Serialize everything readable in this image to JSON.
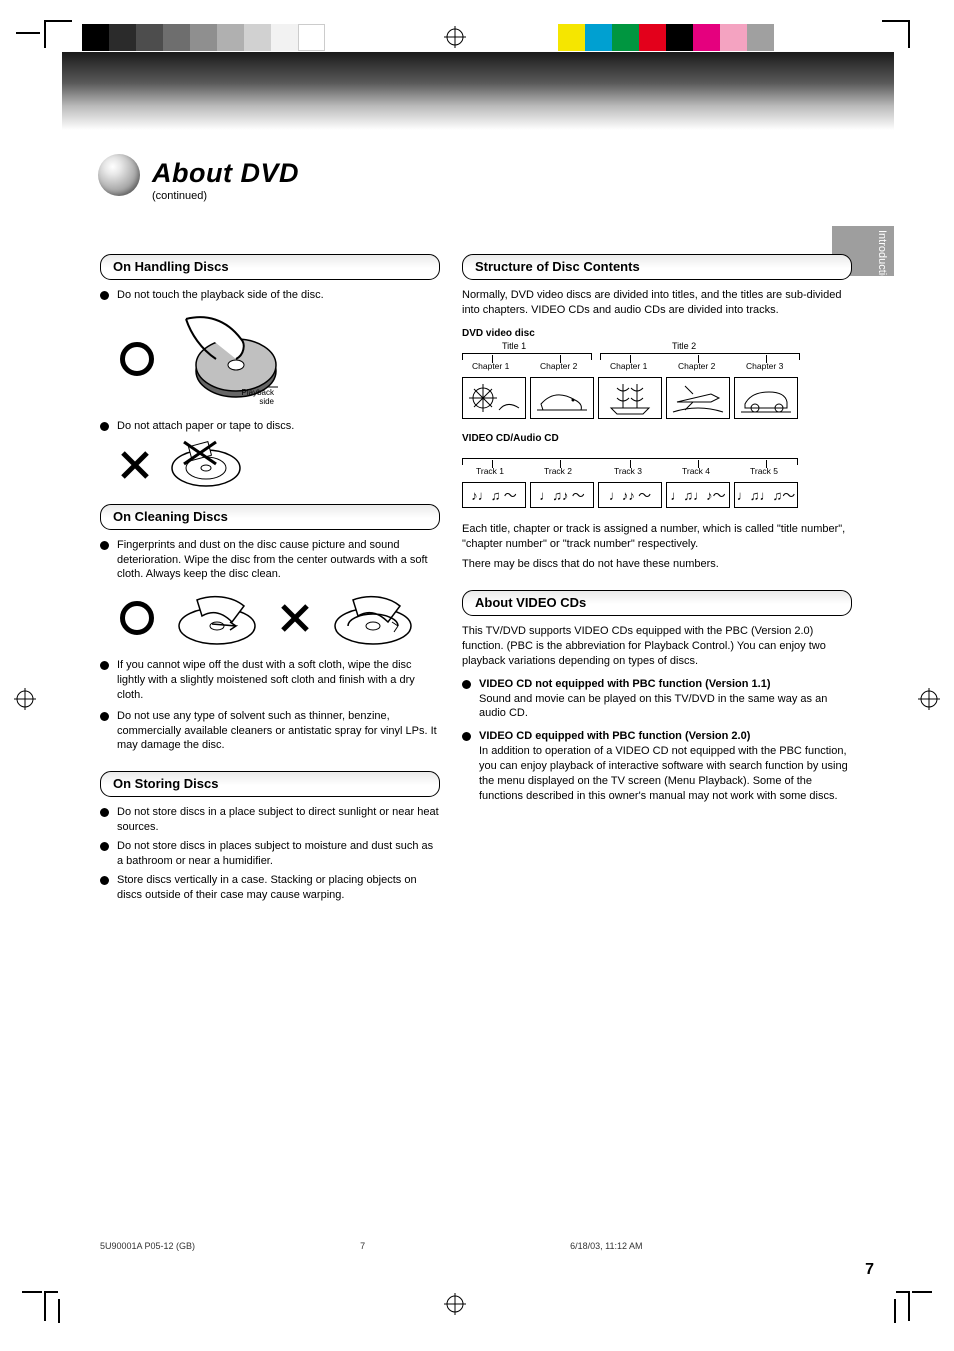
{
  "header": {
    "title": "About DVD",
    "subtitle": "(continued)"
  },
  "side_tab": "Introduction",
  "sections": {
    "handling": {
      "heading": "On Handling Discs",
      "b1": "Do not touch the playback side of the disc.",
      "b2": "Do not attach paper or tape to discs.",
      "img_labels": {
        "playback_side": "Playback side"
      }
    },
    "cleaning": {
      "heading": "On Cleaning Discs",
      "b1": "Fingerprints and dust on the disc cause picture and sound deterioration. Wipe the disc from the center outwards with a soft cloth. Always keep the disc clean.",
      "b2": "If you cannot wipe off the dust with a soft cloth, wipe the disc lightly with a slightly moistened soft cloth and finish with a dry cloth.",
      "b3": "Do not use any type of solvent such as thinner, benzine, commercially available cleaners or antistatic spray for vinyl LPs. It may damage the disc."
    },
    "storing": {
      "heading": "On Storing Discs",
      "b1": "Do not store discs in a place subject to direct sunlight or near heat sources.",
      "b2": "Do not store discs in places subject to moisture and dust such as a bathroom or near a humidifier.",
      "b3": "Store discs vertically in a case. Stacking or placing objects on discs outside of their case may cause warping."
    },
    "structure": {
      "heading": "Structure of Disc Contents",
      "p1": "Normally, DVD video discs are divided into titles, and the titles are sub-divided into chapters. VIDEO CDs and audio CDs are divided into tracks.",
      "dvd_label": "DVD video disc",
      "title1": "Title 1",
      "title2": "Title 2",
      "ch1": "Chapter 1",
      "ch2": "Chapter 2",
      "ch3": "Chapter 1",
      "ch4": "Chapter 2",
      "ch5": "Chapter 3",
      "cd_label": "VIDEO CD/Audio CD",
      "t1": "Track 1",
      "t2": "Track 2",
      "t3": "Track 3",
      "t4": "Track 4",
      "t5": "Track 5",
      "p2": "Each title, chapter or track is assigned a number, which is called \"title number\", \"chapter number\" or \"track number\" respectively.",
      "p3": "There may be discs that do not have these numbers."
    },
    "pbc": {
      "heading": "About VIDEO CDs",
      "p1": "This TV/DVD supports VIDEO CDs equipped with the PBC (Version 2.0) function. (PBC is the abbreviation for Playback Control.) You can enjoy two playback variations depending on types of discs.",
      "b1_label": "VIDEO CD not equipped with PBC function (Version 1.1)",
      "b1_body": "Sound and movie can be played on this TV/DVD in the same way as an audio CD.",
      "b2_label": "VIDEO CD equipped with PBC function (Version 2.0)",
      "b2_body": "In addition to operation of a VIDEO CD not equipped with the PBC function, you can enjoy playback of interactive software with search function by using the menu displayed on the TV screen (Menu Playback). Some of the functions described in this owner's manual may not work with some discs."
    }
  },
  "footer": {
    "line": "5U90001A P05-12  (GB)",
    "line2": "6/18/03, 11:12 AM",
    "page_left": "7",
    "page_number": "7"
  },
  "colors": {
    "gray_swatches": [
      "#000000",
      "#2b2b2b",
      "#4d4d4d",
      "#6e6e6e",
      "#8f8f8f",
      "#b0b0b0",
      "#d1d1d1",
      "#f2f2f2",
      "#ffffff"
    ],
    "color_swatches": [
      "#f5e600",
      "#00a0d1",
      "#009640",
      "#e3001b",
      "#000000",
      "#e5007e",
      "#f4a3c1",
      "#a0a0a0"
    ]
  }
}
